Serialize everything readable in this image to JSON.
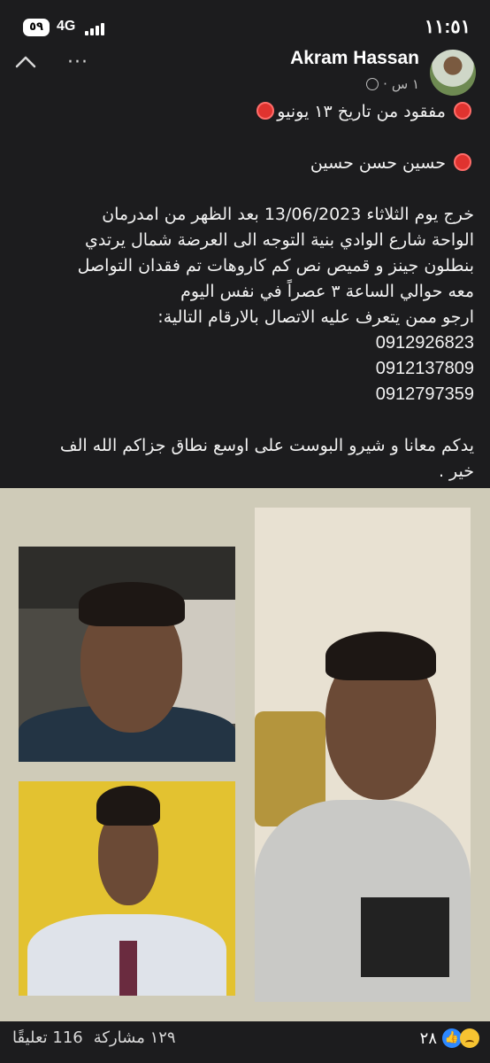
{
  "status_bar": {
    "time": "١١:٥١",
    "battery": "٥٩",
    "network": "4G"
  },
  "post": {
    "author": "Akram Hassan",
    "time_ago": "١ س",
    "separator": "·",
    "audience_icon": "globe-icon",
    "lines": [
      "مفقود من تاريخ ١٣ يونيو",
      "",
      "حسين حسن حسين",
      "",
      "خرج  يوم الثلاثاء  13/06/2023 بعد الظهر من امدرمان",
      "الواحة شارع الوادي بنية التوجه الى العرضة شمال يرتدي",
      "بنطلون جينز و قميص نص كم كاروهات تم فقدان التواصل",
      "معه حوالي الساعة ٣ عصراً في نفس اليوم",
      "ارجو ممن يتعرف عليه الاتصال بالارقام التالية:"
    ],
    "phones": [
      "0912926823",
      "0912137809",
      "0912797359"
    ],
    "closing_lines": [
      "يدكم معانا و شيرو البوست على اوسع نطاق جزاكم الله الف",
      "خير ."
    ]
  },
  "photos": {
    "background_color": "#cfcbb8",
    "accent_yellow": "#e3c230"
  },
  "reactions": {
    "count": "٢٨",
    "like_icon": "like-icon",
    "sad_icon": "sad-icon",
    "shares": "١٢٩ مشاركة",
    "comments": "116 تعليقًا"
  }
}
